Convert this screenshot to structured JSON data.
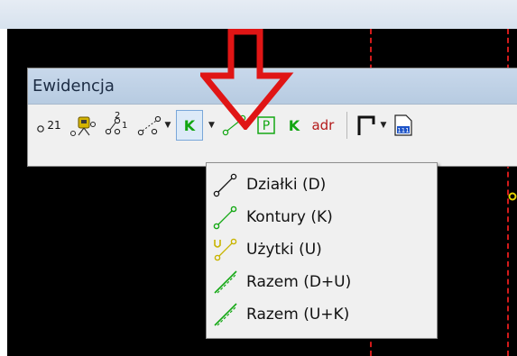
{
  "toolbar_window": {
    "title": "Ewidencja"
  },
  "toolbar": {
    "buttons": [
      {
        "name": "numbering",
        "icon": "point-number-21-icon",
        "text": "21"
      },
      {
        "name": "surveyor",
        "icon": "surveyor-points-icon"
      },
      {
        "name": "point-pair-numbering",
        "icon": "point-numbering-21-icon",
        "text_top": "2",
        "text_bottom": "1"
      },
      {
        "name": "line-points",
        "icon": "line-points-icon"
      },
      {
        "name": "contour-k",
        "icon": "contour-k-icon",
        "text": "K"
      },
      {
        "name": "green-line",
        "icon": "green-line-icon"
      },
      {
        "name": "p-box",
        "icon": "p-box-icon",
        "text": "P"
      },
      {
        "name": "k-label",
        "icon": "k-letter-icon",
        "text": "K"
      },
      {
        "name": "adr",
        "icon": "adr-icon",
        "text": "adr"
      },
      {
        "name": "polyline",
        "icon": "polyline-icon"
      },
      {
        "name": "document-111",
        "icon": "document-icon",
        "text": "111"
      }
    ]
  },
  "menu": {
    "items": [
      {
        "label": "Działki (D)",
        "icon": "parcel-line-icon",
        "color": "#111111"
      },
      {
        "label": "Kontury (K)",
        "icon": "contour-line-icon",
        "color": "#14a814"
      },
      {
        "label": "Użytki (U)",
        "icon": "land-use-icon",
        "color": "#c8b400"
      },
      {
        "label": "Razem (D+U)",
        "icon": "combined-du-icon",
        "color": "#14a814"
      },
      {
        "label": "Razem (U+K)",
        "icon": "combined-uk-icon",
        "color": "#14a814"
      }
    ]
  },
  "colors": {
    "annotation_arrow": "#e01515",
    "dashed_line": "#d21a1a",
    "canvas": "#000000"
  }
}
